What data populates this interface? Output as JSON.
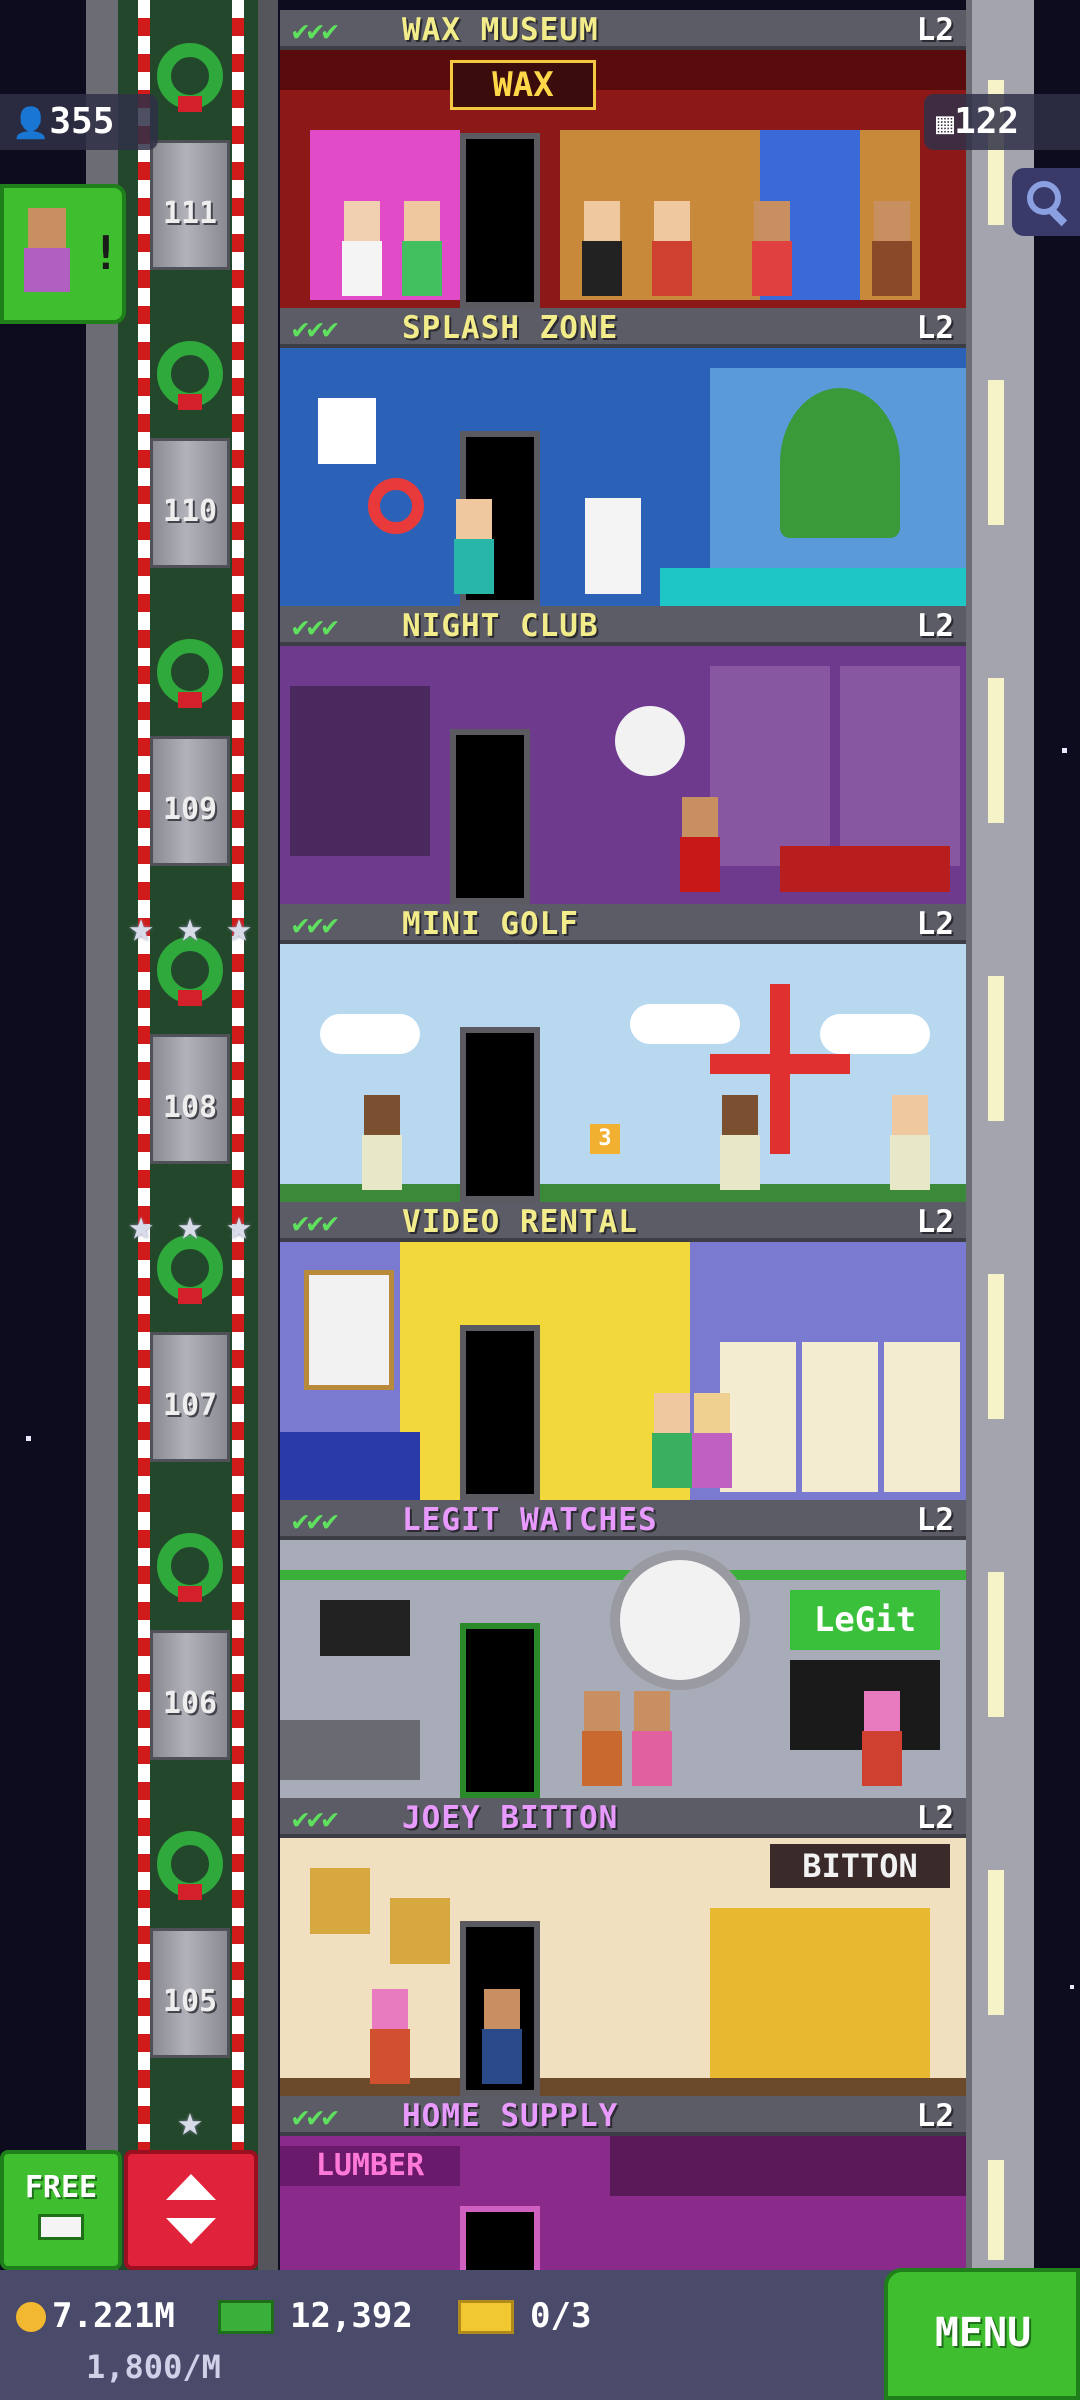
{
  "hud": {
    "population": "355",
    "floors_count": "122",
    "search_icon": "magnifier-icon",
    "notification_mark": "!"
  },
  "floors": [
    {
      "name": "WAX MUSEUM",
      "level": "L2",
      "checks": "✔✔✔"
    },
    {
      "name": "SPLASH ZONE",
      "level": "L2",
      "checks": "✔✔✔"
    },
    {
      "name": "NIGHT CLUB",
      "level": "L2",
      "checks": "✔✔✔"
    },
    {
      "name": "MINI GOLF",
      "level": "L2",
      "checks": "✔✔✔"
    },
    {
      "name": "VIDEO RENTAL",
      "level": "L2",
      "checks": "✔✔✔"
    },
    {
      "name": "LEGIT WATCHES",
      "level": "L2",
      "checks": "✔✔✔"
    },
    {
      "name": "JOEY BITTON",
      "level": "L2",
      "checks": "✔✔✔"
    },
    {
      "name": "HOME SUPPLY",
      "level": "L2",
      "checks": "✔✔✔"
    }
  ],
  "elevator_floors": [
    "111",
    "110",
    "109",
    "108",
    "107",
    "106",
    "105"
  ],
  "signs": {
    "wax": "WAX",
    "legit": "LeGit",
    "bitton": "BITTON",
    "lumber": "LUMBER",
    "golf_flag": "3"
  },
  "controls": {
    "free_label": "FREE",
    "menu_label": "MENU"
  },
  "currency": {
    "coins": "7.221M",
    "bux": "12,392",
    "tickets": "0/3",
    "rate": "1,800/M"
  },
  "colors": {
    "accent_green": "#3fbf2f",
    "elevator_red": "#e0223a",
    "floor_name_yellow": "#f2ec8a"
  }
}
